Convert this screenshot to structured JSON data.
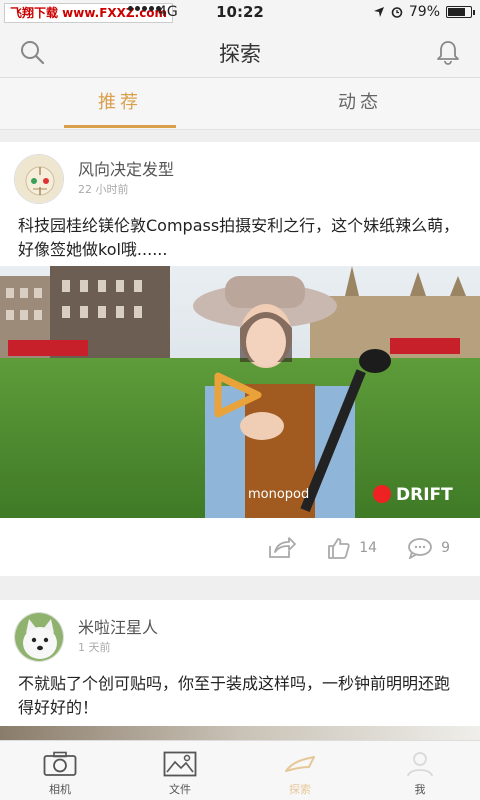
{
  "status_bar": {
    "watermark": "飞翔下载 www.FXXZ.com",
    "network": "4G",
    "time": "10:22",
    "battery": "79%",
    "battery_level": 0.79
  },
  "nav": {
    "title": "探索"
  },
  "tabs": [
    {
      "label": "推荐",
      "active": true
    },
    {
      "label": "动态",
      "active": false
    }
  ],
  "feed": [
    {
      "author": "风向决定发型",
      "time": "22 小时前",
      "text": "科技园桂纶镁伦敦Compass拍摄安利之行，这个妹纸辣么萌，好像签她做kol哦......",
      "video": {
        "subtitle": "monopod",
        "brand": "DRIFT"
      },
      "likes": "14",
      "comments": "9"
    },
    {
      "author": "米啦汪星人",
      "time": "1 天前",
      "text": "不就贴了个创可贴吗，你至于装成这样吗，一秒钟前明明还跑得好好的！"
    }
  ],
  "tabbar": [
    {
      "label": "相机",
      "icon": "camera-icon"
    },
    {
      "label": "文件",
      "icon": "image-icon"
    },
    {
      "label": "探索",
      "icon": "explore-icon",
      "active": true
    },
    {
      "label": "我",
      "icon": "user-icon"
    }
  ],
  "colors": {
    "accent": "#d9a04b",
    "background": "#efefef"
  }
}
